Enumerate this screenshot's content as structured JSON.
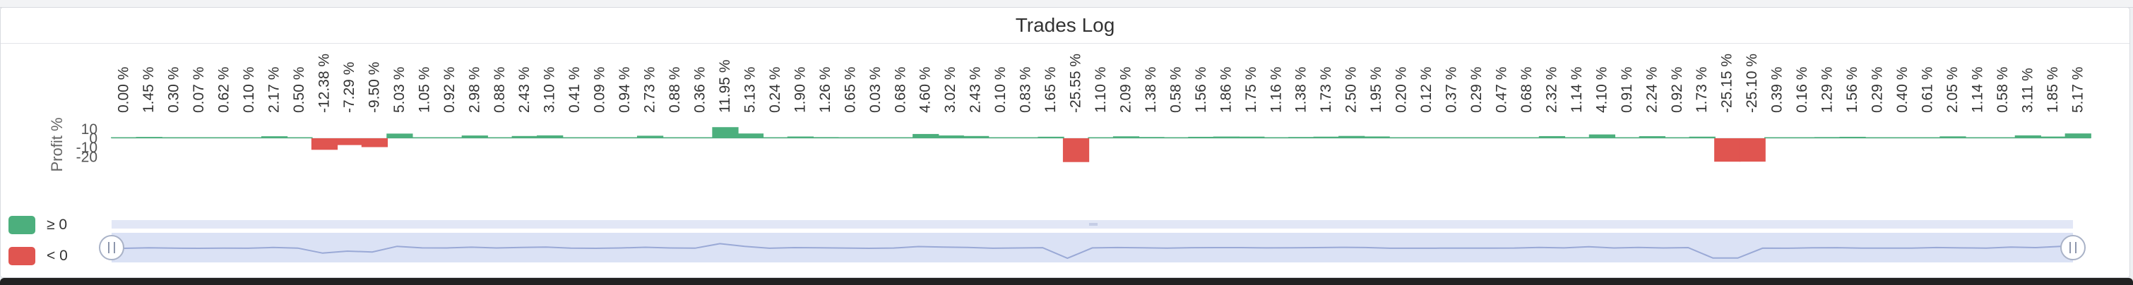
{
  "panel": {
    "title": "Trades Log"
  },
  "legend": [
    {
      "label": "≥ 0",
      "color": "#4caf7d"
    },
    {
      "label": "< 0",
      "color": "#e05550"
    }
  ],
  "colors": {
    "positive": "#4caf7d",
    "negative": "#e05550",
    "zoom_band": "#dbe2f5",
    "zoom_line": "#9aa9d6"
  },
  "chart_data": {
    "type": "bar",
    "ylabel": "Profit %",
    "yticks": [
      10,
      0,
      -10,
      -20
    ],
    "ylim": [
      -20,
      15
    ],
    "grid": false,
    "legend_position": "bottom-left",
    "data_labels": [
      "0.00 %",
      "1.45 %",
      "0.30 %",
      "0.07 %",
      "0.62 %",
      "0.10 %",
      "2.17 %",
      "0.50 %",
      "-12.38 %",
      "-7.29 %",
      "-9.50 %",
      "5.03 %",
      "1.05 %",
      "0.92 %",
      "2.98 %",
      "0.88 %",
      "2.43 %",
      "3.10 %",
      "0.41 %",
      "0.09 %",
      "0.94 %",
      "2.73 %",
      "0.88 %",
      "0.36 %",
      "11.95 %",
      "5.13 %",
      "0.24 %",
      "1.90 %",
      "1.26 %",
      "0.65 %",
      "0.03 %",
      "0.68 %",
      "4.60 %",
      "3.02 %",
      "2.43 %",
      "0.10 %",
      "0.83 %",
      "1.65 %",
      "-25.55 %",
      "1.10 %",
      "2.09 %",
      "1.38 %",
      "0.58 %",
      "1.56 %",
      "1.86 %",
      "1.75 %",
      "1.16 %",
      "1.38 %",
      "1.73 %",
      "2.50 %",
      "1.95 %",
      "0.20 %",
      "0.12 %",
      "0.37 %",
      "0.29 %",
      "0.47 %",
      "0.68 %",
      "2.32 %",
      "1.14 %",
      "4.10 %",
      "0.91 %",
      "2.24 %",
      "0.92 %",
      "1.73 %",
      "-25.15 %",
      "-25.10 %",
      "0.39 %",
      "0.16 %",
      "1.29 %",
      "1.56 %",
      "0.29 %",
      "0.40 %",
      "0.61 %",
      "2.05 %",
      "1.14 %",
      "0.58 %",
      "3.11 %",
      "1.85 %",
      "5.17 %"
    ],
    "values": [
      0.0,
      1.45,
      0.3,
      0.07,
      0.62,
      0.1,
      2.17,
      0.5,
      -12.38,
      -7.29,
      -9.5,
      5.03,
      1.05,
      0.92,
      2.98,
      0.88,
      2.43,
      3.1,
      0.41,
      0.09,
      0.94,
      2.73,
      0.88,
      0.36,
      11.95,
      5.13,
      0.24,
      1.9,
      1.26,
      0.65,
      0.03,
      0.68,
      4.6,
      3.02,
      2.43,
      0.1,
      0.83,
      1.65,
      -25.55,
      1.1,
      2.09,
      1.38,
      0.58,
      1.56,
      1.86,
      1.75,
      1.16,
      1.38,
      1.73,
      2.5,
      1.95,
      0.2,
      0.12,
      0.37,
      0.29,
      0.47,
      0.68,
      2.32,
      1.14,
      4.1,
      0.91,
      2.24,
      0.92,
      1.73,
      -25.15,
      -25.1,
      0.39,
      0.16,
      1.29,
      1.56,
      0.29,
      0.4,
      0.61,
      2.05,
      1.14,
      0.58,
      3.11,
      1.85,
      5.17
    ]
  }
}
